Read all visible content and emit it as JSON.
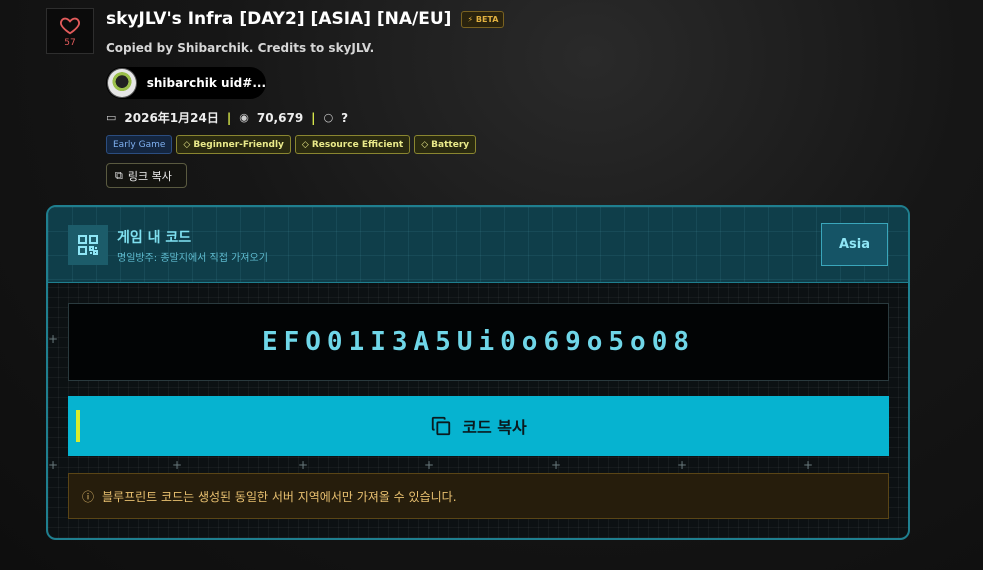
{
  "like": {
    "icon": "heart-icon",
    "count": "57",
    "color": "#e25b5b"
  },
  "header": {
    "title": "skyJLV's Infra [DAY2] [ASIA] [NA/EU]",
    "beta_badge": "BETA",
    "subtitle": "Copied by Shibarchik. Credits to skyJLV."
  },
  "author": {
    "name": "shibarchik uid#..."
  },
  "meta": {
    "date": "2026年1月24日",
    "views": "70,679",
    "comments": "?"
  },
  "tags": [
    {
      "label": "Early Game",
      "style": "blue"
    },
    {
      "label": "Beginner-Friendly",
      "style": "yellow"
    },
    {
      "label": "Resource Efficient",
      "style": "yellow"
    },
    {
      "label": "Battery",
      "style": "yellow"
    }
  ],
  "copy_link": {
    "label": "링크 복사"
  },
  "panel": {
    "title": "게임 내 코드",
    "subtitle": "명일방주: 종말지에서 직접 가져오기",
    "region": "Asia",
    "code": "EFO01I3A5Ui0o69o5o08",
    "copy_button": "코드 복사",
    "notice": "블루프린트 코드는 생성된 동일한 서버 지역에서만 가져올 수 있습니다."
  },
  "colors": {
    "accent": "#06b3d0",
    "panel_border": "#1f7f8f",
    "highlight": "#d8ec2e"
  }
}
